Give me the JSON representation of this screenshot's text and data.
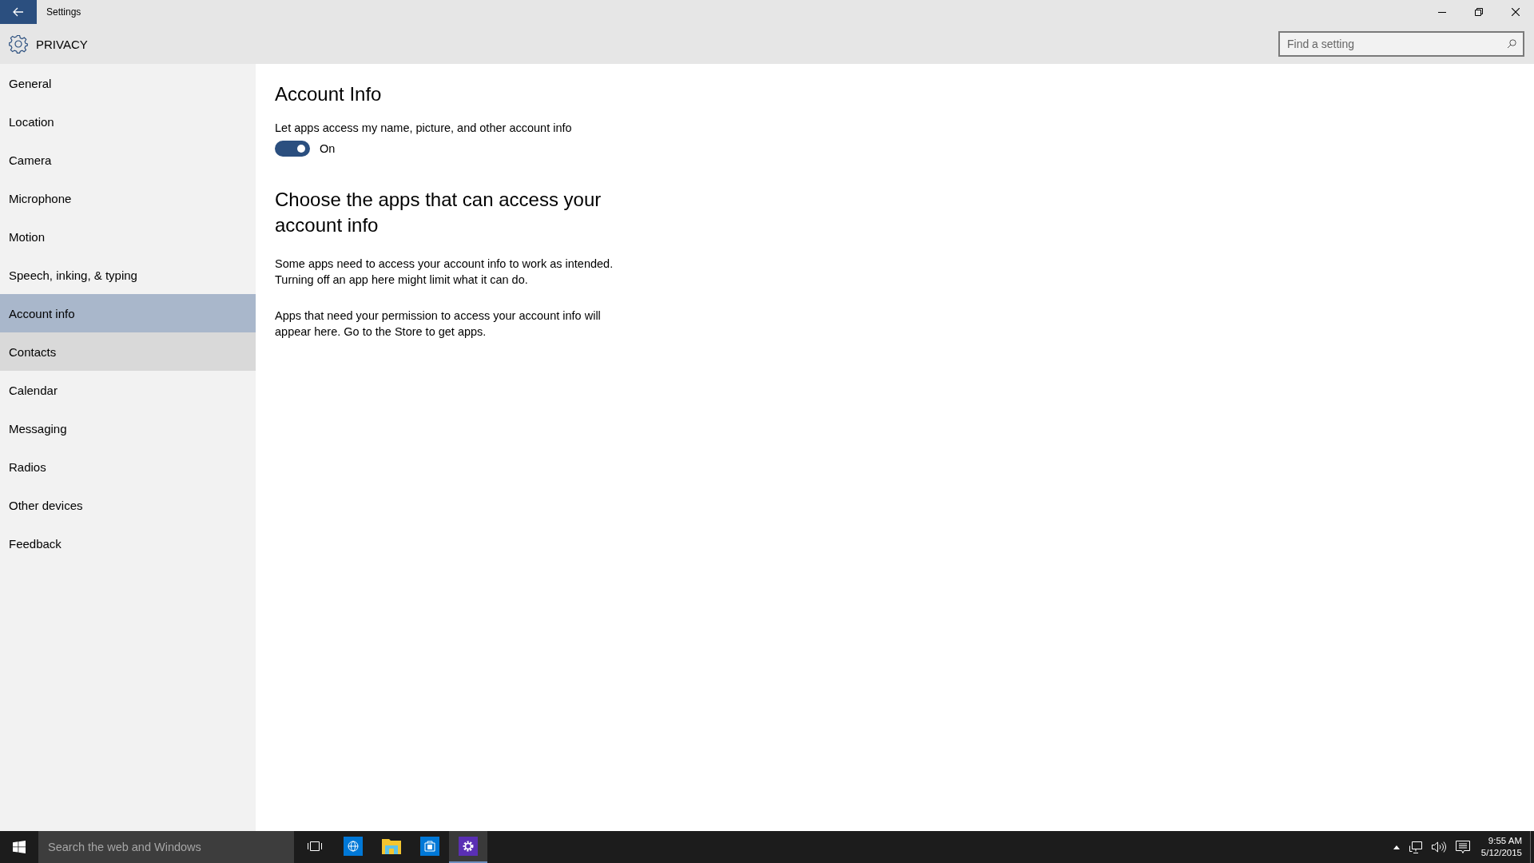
{
  "window": {
    "title": "Settings"
  },
  "header": {
    "title": "PRIVACY",
    "search": {
      "placeholder": "Find a setting"
    }
  },
  "sidebar": {
    "items": [
      {
        "label": "General",
        "selected": false,
        "hovered": false
      },
      {
        "label": "Location",
        "selected": false,
        "hovered": false
      },
      {
        "label": "Camera",
        "selected": false,
        "hovered": false
      },
      {
        "label": "Microphone",
        "selected": false,
        "hovered": false
      },
      {
        "label": "Motion",
        "selected": false,
        "hovered": false
      },
      {
        "label": "Speech, inking, & typing",
        "selected": false,
        "hovered": false
      },
      {
        "label": "Account info",
        "selected": true,
        "hovered": false
      },
      {
        "label": "Contacts",
        "selected": false,
        "hovered": true
      },
      {
        "label": "Calendar",
        "selected": false,
        "hovered": false
      },
      {
        "label": "Messaging",
        "selected": false,
        "hovered": false
      },
      {
        "label": "Radios",
        "selected": false,
        "hovered": false
      },
      {
        "label": "Other devices",
        "selected": false,
        "hovered": false
      },
      {
        "label": "Feedback",
        "selected": false,
        "hovered": false
      }
    ]
  },
  "content": {
    "title": "Account Info",
    "toggle": {
      "label": "Let apps access my name, picture, and other account info",
      "on": true,
      "state_text": "On"
    },
    "section_title": "Choose the apps that can access your account info",
    "paragraphs": [
      "Some apps need to access your account info to work as intended. Turning off an app here might limit what it can do.",
      "Apps that need your permission to access your account info will appear here. Go to the Store to get apps."
    ]
  },
  "taskbar": {
    "search": {
      "placeholder": "Search the web and Windows"
    },
    "apps": [
      {
        "kind": "taskview",
        "active": false
      },
      {
        "kind": "browser",
        "active": false
      },
      {
        "kind": "folder",
        "active": false
      },
      {
        "kind": "store",
        "active": false
      },
      {
        "kind": "settings",
        "active": true
      }
    ],
    "clock": {
      "time": "9:55 AM",
      "date": "5/12/2015"
    }
  }
}
